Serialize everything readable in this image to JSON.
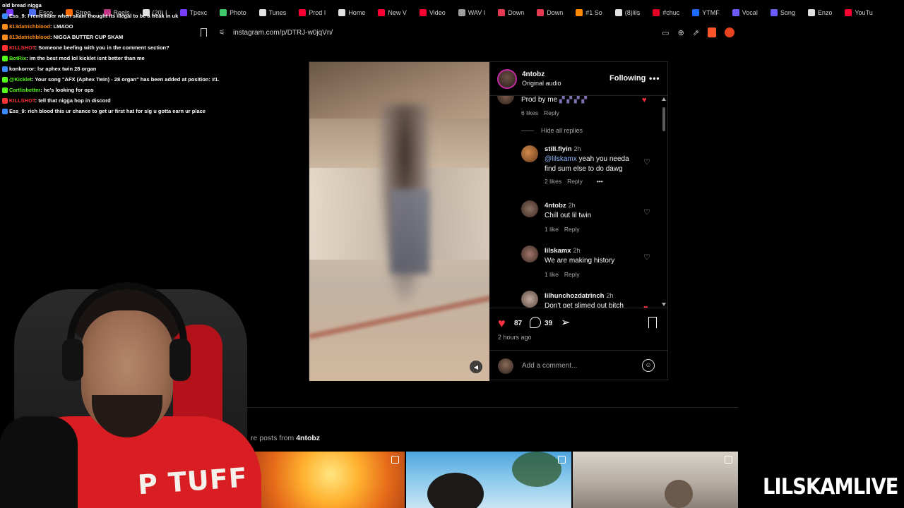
{
  "browser": {
    "bookmarks": [
      {
        "label": "",
        "color": "#7a3cff"
      },
      {
        "label": "Esco",
        "color": "#4c6ef5"
      },
      {
        "label": "Stree",
        "color": "#ff6b00"
      },
      {
        "label": "Reels",
        "color": "#c13584"
      },
      {
        "label": "(20) I",
        "color": "#e0e0e0"
      },
      {
        "label": "Tpexc",
        "color": "#7a3cff"
      },
      {
        "label": "Photo",
        "color": "#3ec96d"
      },
      {
        "label": "Tunes",
        "color": "#e0e0e0"
      },
      {
        "label": "Prod I",
        "color": "#ff0033"
      },
      {
        "label": "Home",
        "color": "#e0e0e0"
      },
      {
        "label": "New V",
        "color": "#ff0033"
      },
      {
        "label": "Video",
        "color": "#ff0033"
      },
      {
        "label": "WAV I",
        "color": "#9e9e9e"
      },
      {
        "label": "Down",
        "color": "#e63950"
      },
      {
        "label": "Down",
        "color": "#e63950"
      },
      {
        "label": "#1 So",
        "color": "#ff8a00"
      },
      {
        "label": "(8)lils",
        "color": "#e0e0e0"
      },
      {
        "label": "#chuc",
        "color": "#e60023"
      },
      {
        "label": "YTMF",
        "color": "#1e6bff"
      },
      {
        "label": "Vocal",
        "color": "#6a5cff"
      },
      {
        "label": "Song",
        "color": "#6a5cff"
      },
      {
        "label": "Enzo",
        "color": "#e0e0e0"
      },
      {
        "label": "YouTu",
        "color": "#ff0033"
      }
    ],
    "url": "instagram.com/p/DTRJ-w0jqVn/"
  },
  "chat": [
    {
      "user": "",
      "color": "#ffffff",
      "text": "old bread nigga"
    },
    {
      "user": "Ess_9",
      "color": "#ffffff",
      "text": ": I remember when skam thought its illegal to be a freak in uk"
    },
    {
      "user": "813datrichblood",
      "color": "#ff8c1a",
      "text": ": LMAOO"
    },
    {
      "user": "813datrichblood",
      "color": "#ff8c1a",
      "text": ": NIGGA BUTTER CUP SKAM"
    },
    {
      "user": "KILLSHOT",
      "color": "#ff3333",
      "text": ": Someone beefing with you in the comment section?"
    },
    {
      "user": "BotRix",
      "color": "#53fc18",
      "text": ": im the best mod lol kicklet isnt better than me"
    },
    {
      "user": "konkorror",
      "color": "#ffffff",
      "text": ": lsr aphex twin 28 organ"
    },
    {
      "user": "@Kicklet",
      "color": "#53fc18",
      "text": ": Your song \"AFX (Aphex Twin) - 28 organ\" has been added at position: #1."
    },
    {
      "user": "Cartlisbetter",
      "color": "#53fc18",
      "text": ": he's looking for ops"
    },
    {
      "user": "KILLSHOT",
      "color": "#ff3333",
      "text": ": tell that nigga hop in discord"
    },
    {
      "user": "Ess_9",
      "color": "#ffffff",
      "text": ": rich blood this ur chance to get ur first hat for slg u gotta earn ur place"
    }
  ],
  "post": {
    "username": "4ntobz",
    "audio": "Original audio",
    "follow_label": "Following",
    "more": "•••",
    "comments": [
      {
        "name": "",
        "time": "",
        "text": "Prod by me",
        "likes": "6 likes",
        "reply": "Reply",
        "liked": true
      },
      {
        "name": "still.flyin",
        "time": "2h",
        "mention": "@lilskamx",
        "text": " yeah you needa find sum else to do dawg",
        "likes": "2 likes",
        "reply": "Reply",
        "liked": false
      },
      {
        "name": "4ntobz",
        "time": "2h",
        "text": "Chill out lil twin",
        "likes": "1 like",
        "reply": "Reply",
        "liked": false
      },
      {
        "name": "lilskamx",
        "time": "2h",
        "text": "We are making history",
        "likes": "1 like",
        "reply": "Reply",
        "liked": false
      },
      {
        "name": "lilhunchozdatrinch",
        "time": "2h",
        "text": "Don't get slimed out bitch",
        "liked": true
      }
    ],
    "hide_replies": "Hide all replies",
    "like_count": "87",
    "comment_count": "39",
    "posted_ago": "2 hours ago",
    "add_comment_placeholder": "Add a comment...",
    "more_posts_prefix": "re posts from ",
    "more_posts_user": "4ntobz"
  },
  "webcam": {
    "shirt_text": "P TUFF"
  },
  "watermark": "LILSKAMLIVE",
  "colors": {
    "like_red": "#ff3040",
    "mention_blue": "#8fb7ff",
    "brand_accent": "#c32aa3"
  }
}
